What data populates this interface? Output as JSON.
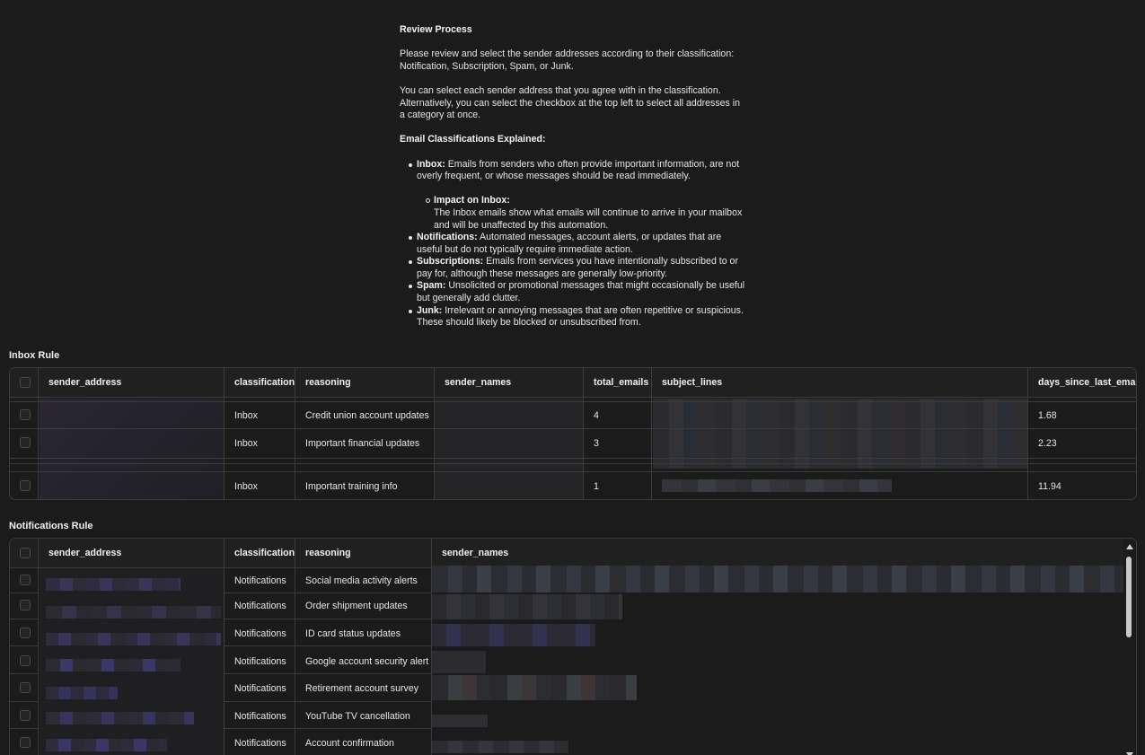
{
  "review": {
    "title": "Review Process",
    "para1": "Please review and select the sender addresses according to their classification: Notification, Subscription, Spam, or Junk.",
    "para2": "You can select each sender address that you agree with in the classification. Alternatively, you can select the checkbox at the top left to select all addresses in a category at once.",
    "explained_title": "Email Classifications Explained:",
    "items": [
      {
        "term": "Inbox:",
        "text": " Emails from senders who often provide important information, are not overly frequent, or whose messages should be read immediately."
      },
      {
        "term": "Notifications:",
        "text": " Automated messages, account alerts, or updates that are useful but do not typically require immediate action."
      },
      {
        "term": "Subscriptions:",
        "text": " Emails from services you have intentionally subscribed to or pay for, although these messages are generally low-priority."
      },
      {
        "term": "Spam:",
        "text": " Unsolicited or promotional messages that might occasionally be useful but generally add clutter."
      },
      {
        "term": "Junk:",
        "text": " Irrelevant or annoying messages that are often repetitive or suspicious. These should likely be blocked or unsubscribed from."
      }
    ],
    "inbox_sub": {
      "term": "Impact on Inbox:",
      "text": "The Inbox emails show what emails will continue to arrive in your mailbox and will be unaffected by this automation."
    }
  },
  "inbox_rule": {
    "title": "Inbox Rule",
    "columns": [
      "sender_address",
      "classification",
      "reasoning",
      "sender_names",
      "total_emails",
      "subject_lines",
      "days_since_last_email"
    ],
    "rows": [
      {
        "classification": "Inbox",
        "reasoning": "Credit union account updates",
        "total_emails": "4",
        "days": "1.68"
      },
      {
        "classification": "Inbox",
        "reasoning": "Important financial updates",
        "total_emails": "3",
        "days": "2.23"
      },
      {
        "classification": "Inbox",
        "reasoning": "Important training info",
        "total_emails": "1",
        "days": "11.94"
      }
    ]
  },
  "notifications_rule": {
    "title": "Notifications Rule",
    "columns": [
      "sender_address",
      "classification",
      "reasoning",
      "sender_names"
    ],
    "rows": [
      {
        "classification": "Notifications",
        "reasoning": "Social media activity alerts"
      },
      {
        "classification": "Notifications",
        "reasoning": "Order shipment updates"
      },
      {
        "classification": "Notifications",
        "reasoning": "ID card status updates"
      },
      {
        "classification": "Notifications",
        "reasoning": "Google account security alert"
      },
      {
        "classification": "Notifications",
        "reasoning": "Retirement account survey"
      },
      {
        "classification": "Notifications",
        "reasoning": "YouTube TV cancellation"
      },
      {
        "classification": "Notifications",
        "reasoning": "Account confirmation"
      }
    ]
  }
}
